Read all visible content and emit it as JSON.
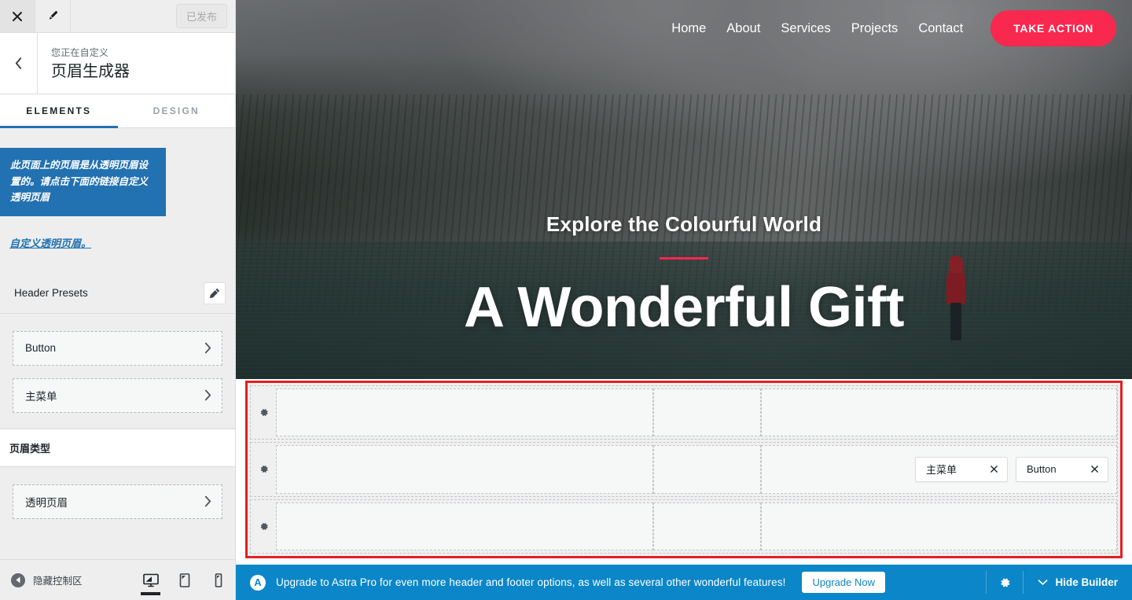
{
  "sidebar": {
    "topbar": {
      "close_icon": "close-icon",
      "brush_icon": "brush-icon",
      "publish_label": "已发布"
    },
    "panel": {
      "back_icon": "chevron-left-icon",
      "eyebrow": "您正在自定义",
      "title": "页眉生成器"
    },
    "tabs": [
      {
        "label": "ELEMENTS",
        "active": true
      },
      {
        "label": "DESIGN",
        "active": false
      }
    ],
    "notice": {
      "text": "此页面上的页眉是从透明页眉设置的。请点击下面的链接自定义透明页眉",
      "link": "自定义透明页眉。"
    },
    "presets": {
      "label": "Header Presets",
      "edit_icon": "pencil-icon"
    },
    "elements": [
      {
        "label": "Button",
        "chevron": "chevron-right-icon"
      },
      {
        "label": "主菜单",
        "chevron": "chevron-right-icon"
      }
    ],
    "header_type": {
      "section_title": "页眉类型",
      "items": [
        {
          "label": "透明页眉",
          "chevron": "chevron-right-icon"
        }
      ]
    },
    "footer": {
      "collapse_label": "隐藏控制区",
      "collapse_icon": "collapse-left-icon",
      "devices": [
        {
          "name": "desktop",
          "icon": "desktop-icon",
          "active": true
        },
        {
          "name": "tablet",
          "icon": "tablet-icon",
          "active": false
        },
        {
          "name": "mobile",
          "icon": "mobile-icon",
          "active": false
        }
      ]
    }
  },
  "preview": {
    "nav": {
      "links": [
        "Home",
        "About",
        "Services",
        "Projects",
        "Contact"
      ],
      "cta_label": "TAKE ACTION"
    },
    "hero": {
      "subtitle": "Explore the Colourful World",
      "title": "A Wonderful Gift"
    }
  },
  "builder": {
    "outline_color": "#e32020",
    "rows": [
      {
        "gear_icon": "gear-icon",
        "chips": []
      },
      {
        "gear_icon": "gear-icon",
        "chips": [
          {
            "label": "主菜单",
            "remove_icon": "close-icon"
          },
          {
            "label": "Button",
            "remove_icon": "close-icon"
          }
        ]
      },
      {
        "gear_icon": "gear-icon",
        "chips": []
      }
    ]
  },
  "astra_bar": {
    "logo_glyph": "A",
    "message": "Upgrade to Astra Pro for even more header and footer options, as well as several other wonderful features!",
    "upgrade_label": "Upgrade Now",
    "gear_icon": "gear-icon",
    "hide_label": "Hide Builder",
    "hide_icon": "chevron-down-icon",
    "background": "#0b86c8"
  },
  "colors": {
    "accent_pink": "#f9284f",
    "notice_blue": "#2271b1",
    "astra_blue": "#0b86c8",
    "outline_red": "#e32020"
  }
}
